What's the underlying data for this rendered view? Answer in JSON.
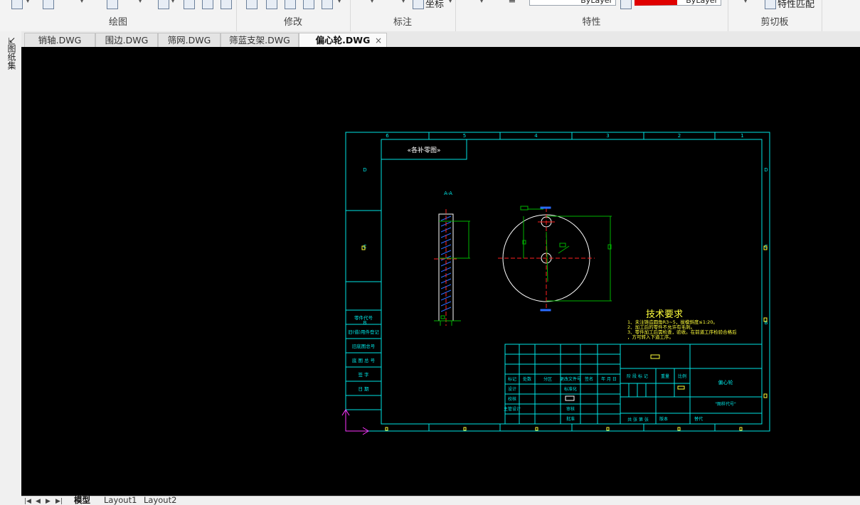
{
  "ribbon": {
    "groups": [
      {
        "label": "绘图"
      },
      {
        "label": "修改"
      },
      {
        "label": "标注"
      },
      {
        "label": "特性"
      },
      {
        "label": "剪切板"
      }
    ],
    "coord_label": "坐标",
    "bylayer_1": "ByLayer",
    "bylayer_2": "ByLayer",
    "match_props": "特性匹配"
  },
  "left_panel": {
    "label": "图纸集"
  },
  "doc_tabs": [
    {
      "label": "销轴.DWG"
    },
    {
      "label": "围边.DWG"
    },
    {
      "label": "筛网.DWG"
    },
    {
      "label": "筛蓝支架.DWG"
    },
    {
      "label": "偏心轮.DWG",
      "active": true
    }
  ],
  "close_glyph": "×",
  "layout_tabs": [
    {
      "label": "模型",
      "active": true
    },
    {
      "label": "Layout1"
    },
    {
      "label": "Layout2"
    }
  ],
  "drawing": {
    "top_label": "«各补零图»",
    "section_label": "A-A",
    "tech_title": "技术要求",
    "tech_lines": [
      "1、未注铸造圆角R3~5，拔模斜度≤1:20。",
      "2、加工后的零件不允许有毛刺。",
      "3、零件加工后需检查，验收。在前道工序检验合格后",
      "，方可转入下道工序。"
    ],
    "zone_numbers": [
      "6",
      "5",
      "4",
      "3",
      "2",
      "1"
    ],
    "zone_letters": [
      "D",
      "C",
      "B"
    ],
    "left_table_rows": [
      "零件代号",
      "旧(借)用件登记",
      "旧底图总号",
      "底 图 总 号",
      "签   字",
      "日   期"
    ],
    "tb_header_row": [
      "标记",
      "处数",
      "分区",
      "更改文件号",
      "签名",
      "年 月 日"
    ],
    "tb_rows": [
      [
        "设计",
        "",
        "",
        "标准化"
      ],
      [
        "校核",
        "",
        "",
        ""
      ],
      [
        "主管设计",
        "",
        "",
        "审核"
      ],
      [
        "",
        "",
        "",
        "批准"
      ]
    ],
    "tb_stage_label": "阶 段 标 记",
    "tb_weight": "重量",
    "tb_scale": "比例",
    "tb_part_name": "偏心轮",
    "tb_drawing_no": "\"图样代号\"",
    "tb_sheet_info": "共  张  第  张",
    "tb_version": "版本",
    "tb_replace": "替代"
  },
  "colors": {
    "frame": "#00e5e5",
    "center": "#ff2020",
    "dim": "#00b400",
    "text": "#ffff3c",
    "white": "#ffffff",
    "blue": "#2a6cff",
    "ucs": "#ff33ff"
  }
}
